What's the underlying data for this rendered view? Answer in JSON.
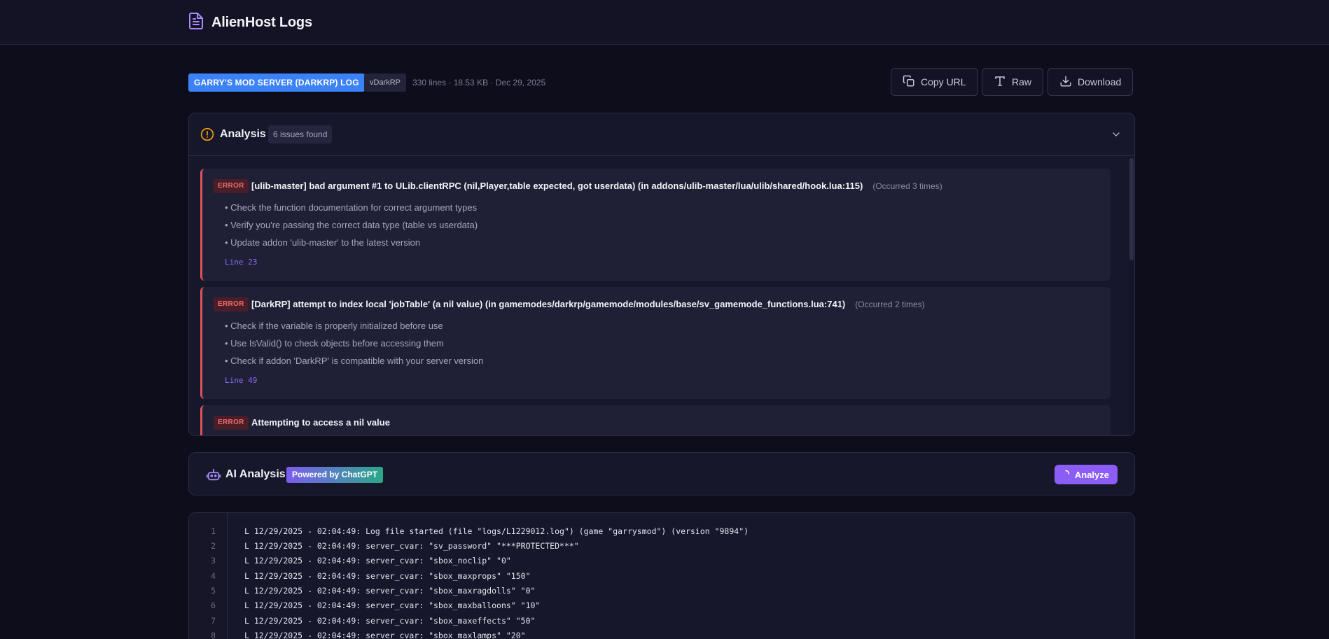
{
  "app": {
    "title": "AlienHost Logs"
  },
  "header": {
    "type_badge": "GARRY'S MOD SERVER (DARKRP) LOG",
    "version_badge": "vDarkRP",
    "meta": "330 lines · 18.53 KB · Dec 29, 2025",
    "buttons": {
      "copy_url": "Copy URL",
      "raw": "Raw",
      "download": "Download"
    }
  },
  "analysis": {
    "title": "Analysis",
    "count": "6 issues found",
    "issues": [
      {
        "level": "ERROR",
        "message": "[ulib-master] bad argument #1 to ULib.clientRPC (nil,Player,table expected, got userdata) (in addons/ulib-master/lua/ulib/shared/hook.lua:115)",
        "occurrence": "(Occurred 3 times)",
        "suggestions": [
          "• Check the function documentation for correct argument types",
          "• Verify you're passing the correct data type (table vs userdata)",
          "• Update addon 'ulib-master' to the latest version"
        ],
        "line": "Line 23"
      },
      {
        "level": "ERROR",
        "message": "[DarkRP] attempt to index local 'jobTable' (a nil value) (in gamemodes/darkrp/gamemode/modules/base/sv_gamemode_functions.lua:741)",
        "occurrence": "(Occurred 2 times)",
        "suggestions": [
          "• Check if the variable is properly initialized before use",
          "• Use IsValid() to check objects before accessing them",
          "• Check if addon 'DarkRP' is compatible with your server version"
        ],
        "line": "Line 49"
      },
      {
        "level": "ERROR",
        "message": "Attempting to access a nil value",
        "occurrence": "",
        "suggestions": [],
        "line": ""
      }
    ]
  },
  "ai": {
    "title": "AI Analysis",
    "badge": "Powered by ChatGPT",
    "button": "Analyze"
  },
  "log": {
    "lines": [
      {
        "n": "1",
        "text": "L 12/29/2025 - 02:04:49: Log file started (file \"logs/L1229012.log\") (game \"garrysmod\") (version \"9894\")"
      },
      {
        "n": "2",
        "text": "L 12/29/2025 - 02:04:49: server_cvar: \"sv_password\" \"***PROTECTED***\""
      },
      {
        "n": "3",
        "text": "L 12/29/2025 - 02:04:49: server_cvar: \"sbox_noclip\" \"0\""
      },
      {
        "n": "4",
        "text": "L 12/29/2025 - 02:04:49: server_cvar: \"sbox_maxprops\" \"150\""
      },
      {
        "n": "5",
        "text": "L 12/29/2025 - 02:04:49: server_cvar: \"sbox_maxragdolls\" \"0\""
      },
      {
        "n": "6",
        "text": "L 12/29/2025 - 02:04:49: server_cvar: \"sbox_maxballoons\" \"10\""
      },
      {
        "n": "7",
        "text": "L 12/29/2025 - 02:04:49: server_cvar: \"sbox_maxeffects\" \"50\""
      },
      {
        "n": "8",
        "text": "L 12/29/2025 - 02:04:49: server_cvar: \"sbox_maxlamps\" \"20\""
      }
    ]
  },
  "colors": {
    "background": "#0d0d1c",
    "panel": "#17172c",
    "accent": "#8b5cf6",
    "error": "#e0525a",
    "badge_blue": "#3b82f6",
    "warning_icon": "#f59e0b"
  },
  "icons": {
    "brand": "document-icon",
    "copy": "copy-icon",
    "raw": "text-icon",
    "download": "download-icon",
    "analysis": "alert-circle-icon",
    "collapse": "chevron-down-icon",
    "ai": "bot-icon",
    "analyze": "spinner-icon"
  }
}
